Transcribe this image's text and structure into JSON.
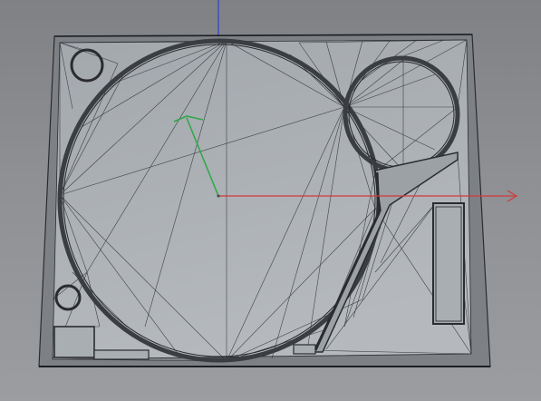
{
  "viewport": {
    "background_top": "#7f8185",
    "background_bottom": "#9b9da0"
  },
  "model": {
    "face_color": "#a7acb1",
    "edge_color": "#1d1f22"
  },
  "axes": {
    "x_color": "#d23a3a",
    "y_color": "#2fa84a",
    "z_color": "#2c3fd6"
  }
}
